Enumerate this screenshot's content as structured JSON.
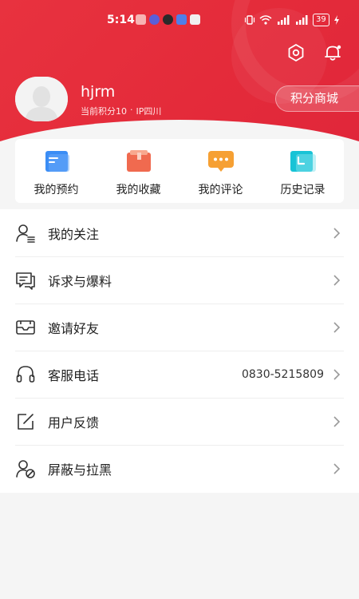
{
  "status_bar": {
    "time": "5:14",
    "battery": "39",
    "network": "5G"
  },
  "header": {
    "settings_icon": "settings-hexagon-icon",
    "bell_icon": "bell-icon",
    "colors": {
      "primary": "#e42b3a",
      "background": "#f5f5f5"
    }
  },
  "profile": {
    "username": "hjrm",
    "points_text": "当前积分10",
    "separator": "·",
    "ip_text": "IP四川",
    "mall_button": "积分商城"
  },
  "shortcuts": [
    {
      "label": "我的预约",
      "icon": "calendar-note-icon",
      "color": "#3b8df5"
    },
    {
      "label": "我的收藏",
      "icon": "folder-bookmark-icon",
      "color": "#f06a4f"
    },
    {
      "label": "我的评论",
      "icon": "comment-bubble-icon",
      "color": "#f6a033"
    },
    {
      "label": "历史记录",
      "icon": "history-clock-icon",
      "color": "#18c3d6"
    }
  ],
  "menu": [
    {
      "label": "我的关注",
      "icon": "user-follow-icon",
      "value": ""
    },
    {
      "label": "诉求与爆料",
      "icon": "chat-report-icon",
      "value": ""
    },
    {
      "label": "邀请好友",
      "icon": "envelope-invite-icon",
      "value": ""
    },
    {
      "label": "客服电话",
      "icon": "headset-icon",
      "value": "0830-5215809"
    },
    {
      "label": "用户反馈",
      "icon": "edit-feedback-icon",
      "value": ""
    },
    {
      "label": "屏蔽与拉黑",
      "icon": "user-block-icon",
      "value": ""
    }
  ]
}
